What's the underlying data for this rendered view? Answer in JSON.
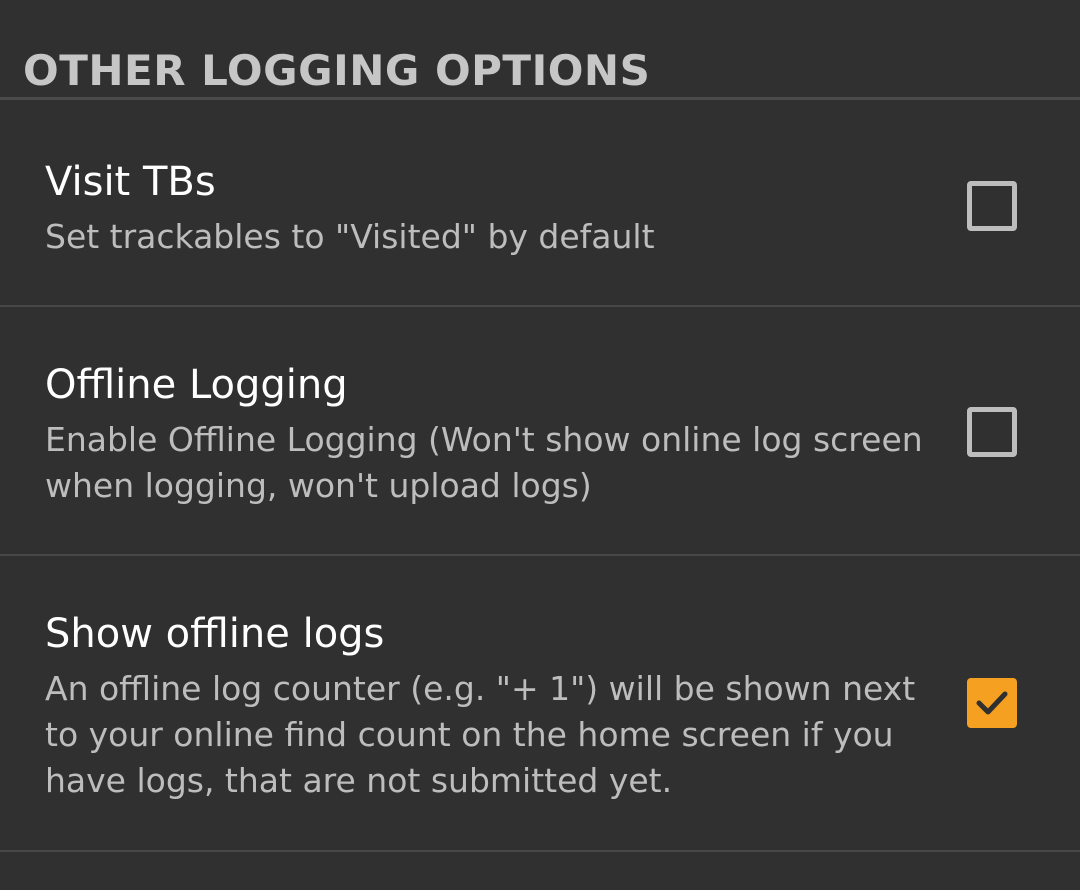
{
  "section": {
    "title": "OTHER LOGGING OPTIONS"
  },
  "preferences": [
    {
      "title": "Visit TBs",
      "summary": "Set trackables to \"Visited\" by default",
      "checked": false
    },
    {
      "title": "Offline Logging",
      "summary": "Enable Offline Logging (Won't show online log screen when logging, won't upload logs)",
      "checked": false
    },
    {
      "title": "Show offline logs",
      "summary": "An offline log counter (e.g. \"+ 1\") will be shown next to your online find count on the home screen if you have logs, that are not submitted yet.",
      "checked": true
    }
  ],
  "colors": {
    "background": "#303030",
    "accent": "#f5a020",
    "checkbox_border": "#bdbdbd"
  },
  "icons": {
    "checked": "checkmark-icon"
  }
}
